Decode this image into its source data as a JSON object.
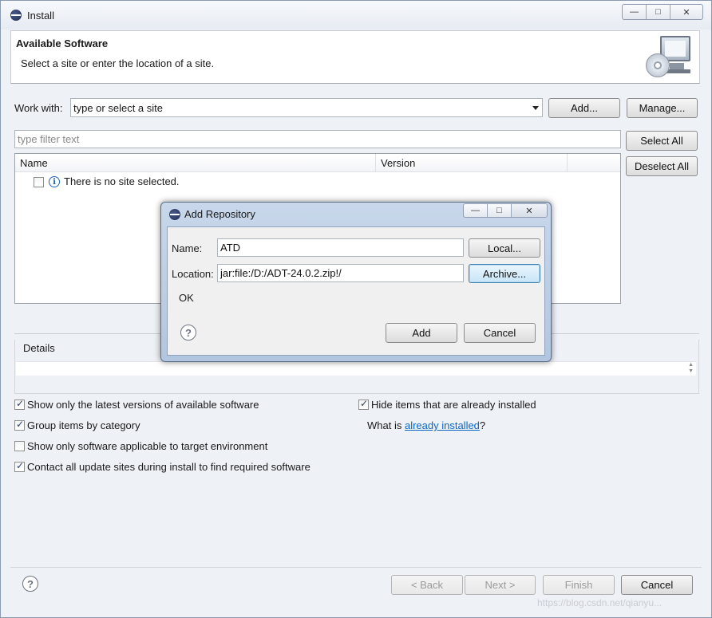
{
  "window": {
    "title": "Install"
  },
  "header": {
    "title": "Available Software",
    "description": "Select a site or enter the location of a site."
  },
  "work_with": {
    "label": "Work with:",
    "value": "type or select a site",
    "add_button": "Add...",
    "manage_button": "Manage..."
  },
  "filter": {
    "placeholder": "type filter text"
  },
  "side_buttons": {
    "select_all": "Select All",
    "deselect_all": "Deselect All"
  },
  "table": {
    "columns": [
      "Name",
      "Version"
    ],
    "empty_message": "There is no site selected."
  },
  "details": {
    "label": "Details"
  },
  "options": {
    "latest_versions": {
      "label": "Show only the latest versions of available software",
      "checked": true
    },
    "group_by_category": {
      "label": "Group items by category",
      "checked": true
    },
    "target_env": {
      "label": "Show only software applicable to target environment",
      "checked": false
    },
    "contact_sites": {
      "label": "Contact all update sites during install to find required software",
      "checked": true
    },
    "hide_installed": {
      "label": "Hide items that are already installed",
      "checked": true
    },
    "what_is_prefix": "What is ",
    "already_installed_link": "already installed",
    "what_is_suffix": "?"
  },
  "footer": {
    "back": "< Back",
    "next": "Next >",
    "finish": "Finish",
    "cancel": "Cancel"
  },
  "dialog": {
    "title": "Add Repository",
    "name_label": "Name:",
    "name_value": "ATD",
    "location_label": "Location:",
    "location_value": "jar:file:/D:/ADT-24.0.2.zip!/",
    "local_button": "Local...",
    "archive_button": "Archive...",
    "status": "OK",
    "add_button": "Add",
    "cancel_button": "Cancel"
  },
  "watermark": "https://blog.csdn.net/qianyu..."
}
